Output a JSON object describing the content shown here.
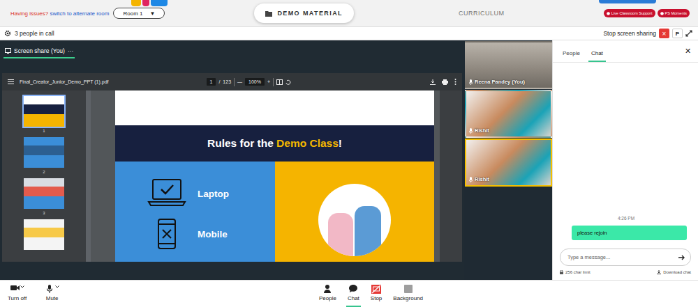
{
  "topbar": {
    "issue_text": "Having issues?",
    "switch_link": "switch to alternate room",
    "room": "Room 1",
    "room_arrow": "▼",
    "tabs": [
      {
        "label": "DEMO MATERIAL",
        "selected": true
      },
      {
        "label": "CURRICULUM",
        "selected": false
      }
    ],
    "pills": [
      "Live Classroom Support",
      "PS Moments"
    ]
  },
  "callbar": {
    "count": "3 people in call",
    "stop_sharing": "Stop screen sharing",
    "close": "×",
    "initial": "P"
  },
  "share": {
    "title": "Screen share (You)",
    "more": "···",
    "viewer": {
      "file": "Final_Creator_Junior_Demo_PPT (1).pdf",
      "page": "1",
      "separator": "/",
      "total": "123",
      "minus": "—",
      "zoom": "100%",
      "plus": "+",
      "thumbnails": [
        {
          "number": "1",
          "selected": true
        },
        {
          "number": "2",
          "selected": false
        },
        {
          "number": "3",
          "selected": false
        },
        {
          "number": "",
          "selected": false
        }
      ]
    },
    "slide": {
      "title_start": "Rules for the ",
      "title_highlight": "Demo Class",
      "title_end": "!",
      "items": [
        {
          "label": "Laptop",
          "allowed": true
        },
        {
          "label": "Mobile",
          "allowed": false
        }
      ]
    }
  },
  "participants": [
    {
      "name": "Reena Pandey (You)",
      "speaking": false
    },
    {
      "name": "Rishit",
      "speaking": false
    },
    {
      "name": "Rishit",
      "speaking": true
    }
  ],
  "side_panel": {
    "tabs": [
      {
        "label": "People",
        "selected": false
      },
      {
        "label": "Chat",
        "selected": true
      }
    ],
    "close": "✕",
    "messages": [
      {
        "time": "4:26 PM",
        "text": "please rejoin"
      }
    ],
    "input": {
      "placeholder": "Type a message..."
    },
    "char_limit": "256 char limit",
    "download": "Download chat"
  },
  "controls": {
    "left": [
      {
        "label": "Turn off",
        "kind": "camera",
        "selected": false
      },
      {
        "label": "Mute",
        "kind": "mic",
        "selected": false
      }
    ],
    "center": [
      {
        "label": "People",
        "kind": "people",
        "selected": false
      },
      {
        "label": "Chat",
        "kind": "chat",
        "selected": true
      },
      {
        "label": "Stop",
        "kind": "stop",
        "selected": false
      },
      {
        "label": "Background",
        "kind": "background",
        "selected": false
      }
    ]
  }
}
